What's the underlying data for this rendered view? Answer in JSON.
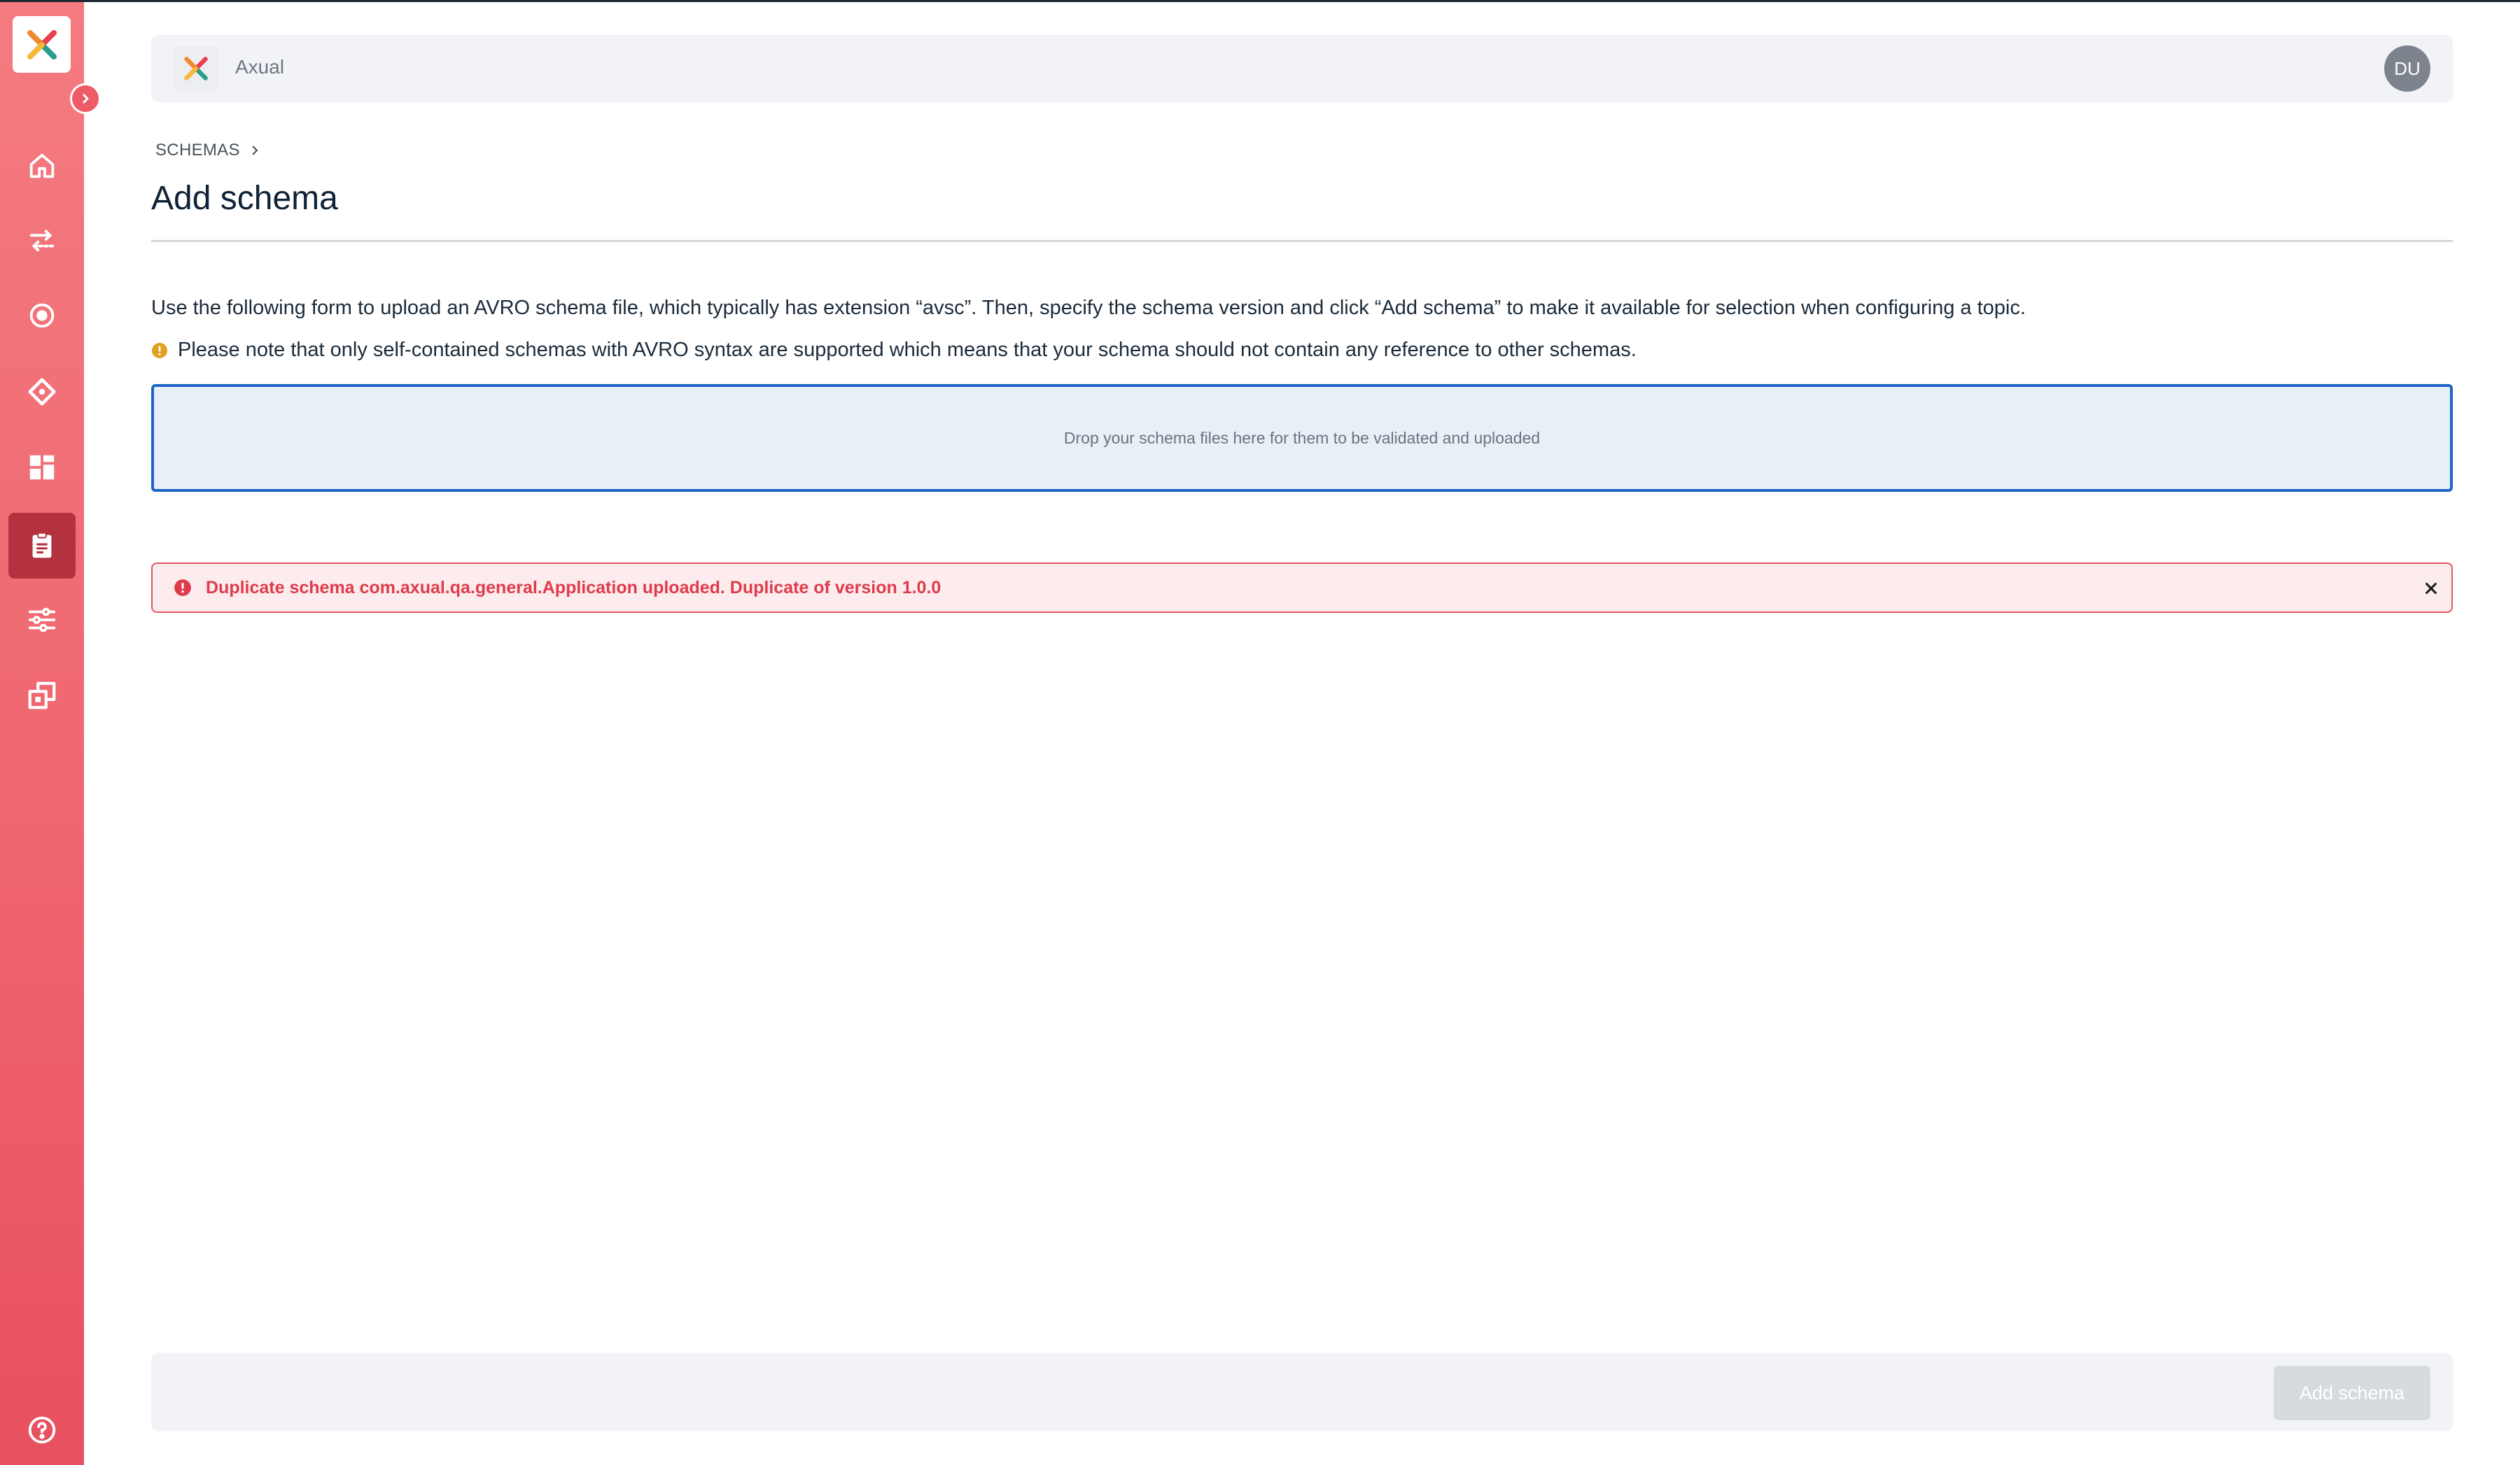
{
  "app": {
    "name": "Axual"
  },
  "user": {
    "initials": "DU"
  },
  "sidebar": {
    "items": [
      {
        "id": "home",
        "icon": "home-icon"
      },
      {
        "id": "streams",
        "icon": "arrows-exchange-icon"
      },
      {
        "id": "environments",
        "icon": "target-icon"
      },
      {
        "id": "applications",
        "icon": "diamond-icon"
      },
      {
        "id": "dashboard",
        "icon": "grid-icon"
      },
      {
        "id": "schemas",
        "icon": "clipboard-icon",
        "active": true
      },
      {
        "id": "settings",
        "icon": "sliders-icon"
      },
      {
        "id": "copy",
        "icon": "copy-icon"
      }
    ],
    "help_icon": "help-circle-icon"
  },
  "breadcrumb": {
    "parent": "SCHEMAS"
  },
  "page": {
    "title": "Add schema",
    "intro": "Use the following form to upload an AVRO schema file, which typically has extension “avsc”. Then, specify the schema version and click “Add schema” to make it available for selection when configuring a topic.",
    "note": "Please note that only self-contained schemas with AVRO syntax are supported which means that your schema should not contain any reference to other schemas."
  },
  "dropzone": {
    "text": "Drop your schema files here for them to be validated and uploaded"
  },
  "alert": {
    "message": "Duplicate schema com.axual.qa.general.Application uploaded. Duplicate of version 1.0.0"
  },
  "footer": {
    "submit_label": "Add schema"
  },
  "colors": {
    "brand": "#ef6670",
    "active_nav": "#b43240",
    "focus_border": "#1e64c8",
    "error": "#df3b4a",
    "warning": "#e0a020"
  }
}
